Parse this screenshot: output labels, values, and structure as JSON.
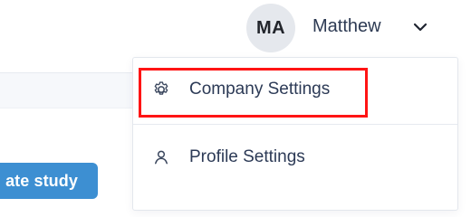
{
  "header": {
    "user": {
      "initials": "MA",
      "name": "Matthew",
      "chevron_icon": "chevron-down-icon"
    }
  },
  "dropdown": {
    "items": [
      {
        "label": "Company Settings",
        "icon": "gear-icon",
        "highlighted": true,
        "highlight_color": "#ff1414"
      },
      {
        "label": "Profile Settings",
        "icon": "user-icon",
        "highlighted": false
      }
    ]
  },
  "page": {
    "create_study_label": "ate study",
    "create_study_color": "#3d8fd2"
  }
}
